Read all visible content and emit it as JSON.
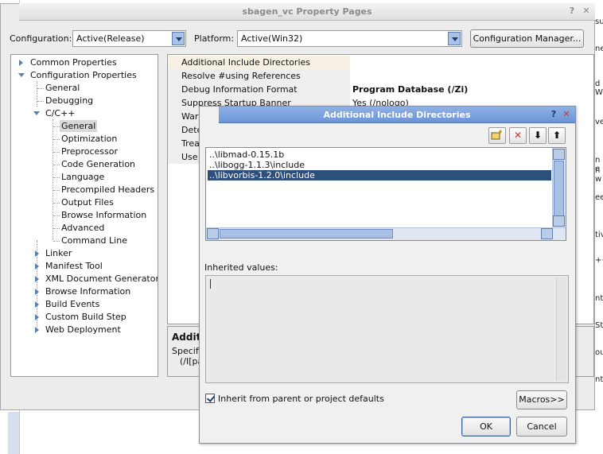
{
  "background": {
    "right_fragments": [
      "su",
      "ne",
      "d W",
      "ve",
      "n e",
      "n w",
      "ee",
      "tiv",
      "++",
      "nt",
      "St",
      "ou",
      "nt"
    ]
  },
  "main": {
    "title": "sbagen_vc Property Pages",
    "help_glyph": "?",
    "close_glyph": "✕",
    "configuration_label": "Configuration:",
    "configuration_value": "Active(Release)",
    "platform_label": "Platform:",
    "platform_value": "Active(Win32)",
    "config_manager_label": "Configuration Manager...",
    "tree": {
      "common_properties": "Common Properties",
      "configuration_properties": "Configuration Properties",
      "general": "General",
      "debugging": "Debugging",
      "cpp": "C/C++",
      "cpp_children": [
        "General",
        "Optimization",
        "Preprocessor",
        "Code Generation",
        "Language",
        "Precompiled Headers",
        "Output Files",
        "Browse Information",
        "Advanced",
        "Command Line"
      ],
      "after": [
        "Linker",
        "Manifest Tool",
        "XML Document Generator",
        "Browse Information",
        "Build Events",
        "Custom Build Step",
        "Web Deployment"
      ]
    },
    "grid": {
      "rows": [
        {
          "name": "Additional Include Directories",
          "value": ""
        },
        {
          "name": "Resolve #using References",
          "value": ""
        },
        {
          "name": "Debug Information Format",
          "value": "Program Database (/Zi)"
        },
        {
          "name": "Suppress Startup Banner",
          "value": "Yes (/nologo)"
        },
        {
          "name": "Warn",
          "value": ""
        },
        {
          "name": "Dete",
          "value": ""
        },
        {
          "name": "Trea",
          "value": ""
        },
        {
          "name": "Use",
          "value": ""
        }
      ]
    },
    "description": {
      "title": "Additi",
      "line1": "Specifie",
      "line2": "(/I[pa"
    }
  },
  "child": {
    "title": "Additional Include Directories",
    "help_glyph": "?",
    "close_glyph": "✕",
    "toolbar": {
      "delete_glyph": "✕",
      "down_glyph": "⬇",
      "up_glyph": "⬆"
    },
    "items": [
      "..\\libmad-0.15.1b",
      "..\\libogg-1.1.3\\include",
      "..\\libvorbis-1.2.0\\include"
    ],
    "inherited_label": "Inherited values:",
    "inherit_checkbox_label": "Inherit from parent or project defaults",
    "macros_label": "Macros>>",
    "ok_label": "OK",
    "cancel_label": "Cancel"
  }
}
